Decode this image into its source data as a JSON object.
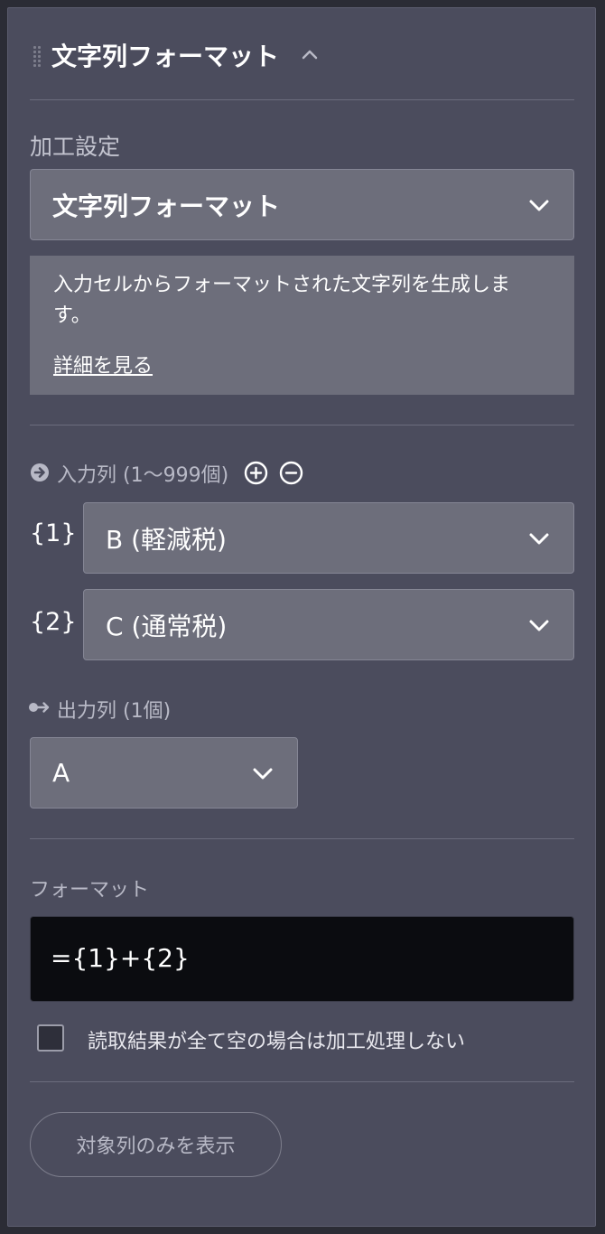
{
  "header": {
    "title": "文字列フォーマット"
  },
  "processing": {
    "label": "加工設定",
    "selected": "文字列フォーマット",
    "description": "入力セルからフォーマットされた文字列を生成しま\nす。",
    "details_link": "詳細を見る"
  },
  "input": {
    "label": "入力列 (1〜999個)",
    "rows": [
      {
        "index": "{1}",
        "value": "B (軽減税)"
      },
      {
        "index": "{2}",
        "value": "C (通常税)"
      }
    ]
  },
  "output": {
    "label": "出力列 (1個)",
    "value": "A"
  },
  "format": {
    "label": "フォーマット",
    "value": "={1}+{2}"
  },
  "skip_empty": {
    "label": "読取結果が全て空の場合は加工処理しない",
    "checked": false
  },
  "show_target_button": "対象列のみを表示",
  "colors": {
    "panel": "#4b4c5d",
    "select": "#6d6e7b",
    "format_field": "#0b0c10"
  },
  "icons": [
    "drag-handle-icon",
    "chevron-up-icon",
    "chevron-down-icon",
    "arrow-right-circle-icon",
    "plus-circle-icon",
    "minus-circle-icon",
    "output-arrow-icon"
  ]
}
